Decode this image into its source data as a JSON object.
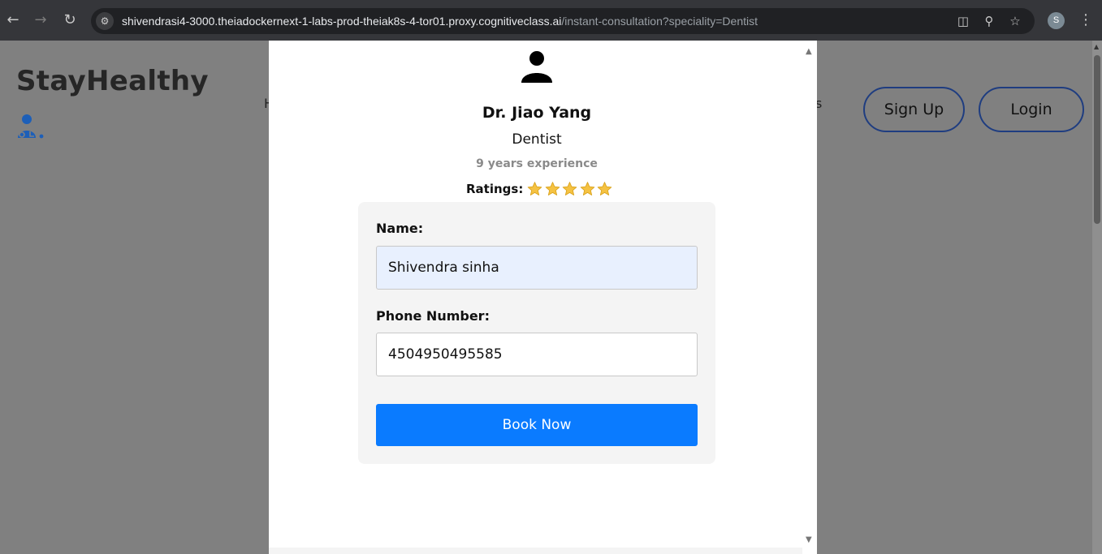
{
  "browser": {
    "url_host": "shivendrasi4-3000.theiadockernext-1-labs-prod-theiak8s-4-tor01.proxy.cognitiveclass.ai",
    "url_path": "/instant-consultation?speciality=Dentist",
    "profile_initial": "S",
    "icons": [
      "back-arrow-icon",
      "forward-arrow-icon",
      "reload-icon",
      "site-info-icon",
      "install-app-icon",
      "zoom-icon",
      "bookmark-star-icon",
      "kebab-menu-icon"
    ]
  },
  "header": {
    "brand": "StayHealthy",
    "nav_partial_left": "H",
    "nav_partial_right": "s",
    "signup_label": "Sign Up",
    "login_label": "Login"
  },
  "doctor": {
    "name": "Dr. Jiao Yang",
    "speciality": "Dentist",
    "experience": "9 years experience",
    "ratings_label": "Ratings:",
    "stars": 5
  },
  "form": {
    "name_label": "Name:",
    "name_value": "Shivendra sinha",
    "phone_label": "Phone Number:",
    "phone_value": "4504950495585",
    "submit_label": "Book Now"
  },
  "colors": {
    "primary_button": "#0a7bff",
    "pill_border": "#1f3d80",
    "star": "#f5c242",
    "autofill_bg": "#e8f0fe"
  }
}
